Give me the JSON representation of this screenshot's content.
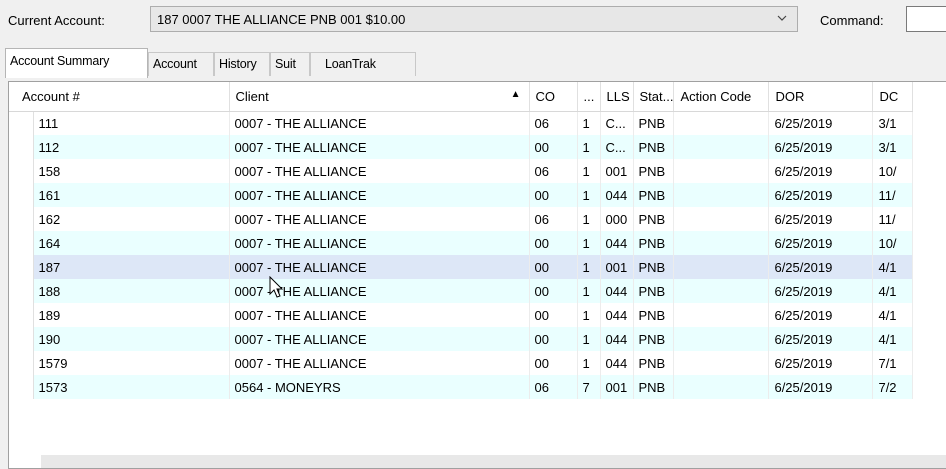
{
  "header": {
    "current_account_label": "Current Account:",
    "current_account_value": "187 0007 THE ALLIANCE PNB 001 $10.00",
    "command_label": "Command:",
    "command_value": ""
  },
  "tabs": [
    {
      "label": "Account Summary",
      "active": true
    },
    {
      "label": "Account",
      "active": false
    },
    {
      "label": "History",
      "active": false
    },
    {
      "label": "Suit",
      "active": false
    },
    {
      "label": "LoanTrak",
      "active": false
    }
  ],
  "grid": {
    "columns": [
      "Account #",
      "Client",
      "CO",
      "...",
      "LLS",
      "Stat...",
      "Action Code",
      "DOR",
      "DC"
    ],
    "sorted_column": "Client",
    "rows": [
      [
        "111",
        "0007 - THE ALLIANCE",
        "06",
        "1",
        "C...",
        "PNB",
        "",
        "6/25/2019",
        "3/1"
      ],
      [
        "112",
        "0007 - THE ALLIANCE",
        "00",
        "1",
        "C...",
        "PNB",
        "",
        "6/25/2019",
        "3/1"
      ],
      [
        "158",
        "0007 - THE ALLIANCE",
        "06",
        "1",
        "001",
        "PNB",
        "",
        "6/25/2019",
        "10/"
      ],
      [
        "161",
        "0007 - THE ALLIANCE",
        "00",
        "1",
        "044",
        "PNB",
        "",
        "6/25/2019",
        "11/"
      ],
      [
        "162",
        "0007 - THE ALLIANCE",
        "06",
        "1",
        "000",
        "PNB",
        "",
        "6/25/2019",
        "11/"
      ],
      [
        "164",
        "0007 - THE ALLIANCE",
        "00",
        "1",
        "044",
        "PNB",
        "",
        "6/25/2019",
        "10/"
      ],
      [
        "187",
        "0007 - THE ALLIANCE",
        "00",
        "1",
        "001",
        "PNB",
        "",
        "6/25/2019",
        "4/1"
      ],
      [
        "188",
        "0007 - THE ALLIANCE",
        "00",
        "1",
        "044",
        "PNB",
        "",
        "6/25/2019",
        "4/1"
      ],
      [
        "189",
        "0007 - THE ALLIANCE",
        "00",
        "1",
        "044",
        "PNB",
        "",
        "6/25/2019",
        "4/1"
      ],
      [
        "190",
        "0007 - THE ALLIANCE",
        "00",
        "1",
        "044",
        "PNB",
        "",
        "6/25/2019",
        "4/1"
      ],
      [
        "1579",
        "0007 - THE ALLIANCE",
        "00",
        "1",
        "044",
        "PNB",
        "",
        "6/25/2019",
        "7/1"
      ],
      [
        "1573",
        "0564 - MONEYRS",
        "06",
        "7",
        "001",
        "PNB",
        "",
        "6/25/2019",
        "7/2"
      ]
    ],
    "selected_row": 6
  },
  "colors": {
    "row_alt": "#eaffff",
    "row_selected": "#dde7f7"
  }
}
